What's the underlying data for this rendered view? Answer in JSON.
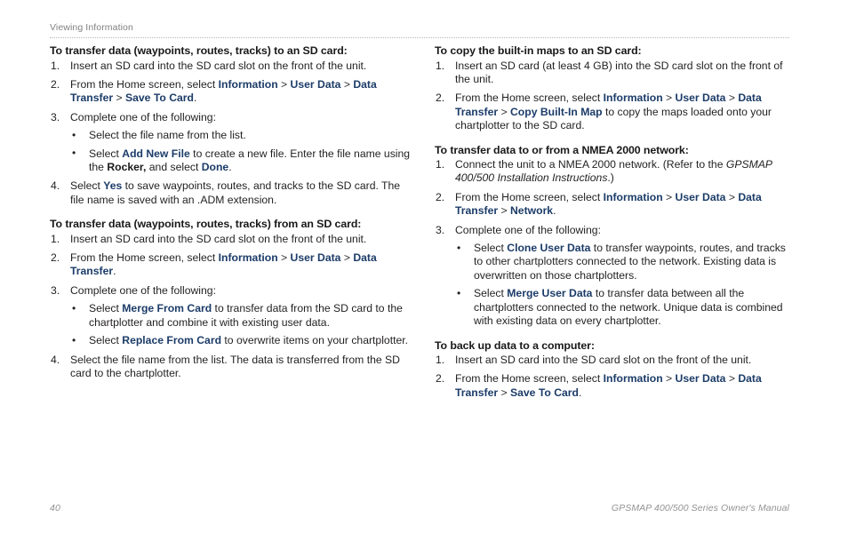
{
  "header": {
    "running_title": "Viewing Information"
  },
  "footer": {
    "page_number": "40",
    "manual_title": "GPSMAP 400/500 Series Owner's Manual"
  },
  "chevron": ">",
  "bullet_glyph": "•",
  "colors": {
    "ui_label_blue": "#1c3c68",
    "body_text": "#221f1f",
    "heading": "#191919",
    "muted_gray": "#939393",
    "rule_gray": "#b9b9b9",
    "page_background": "#ffffff"
  },
  "left_column": {
    "sections": [
      {
        "heading": "To transfer data (waypoints, routes, tracks) to an SD card:",
        "steps": [
          {
            "number": "1.",
            "parts": [
              {
                "type": "text",
                "text": "Insert an SD card into the SD card slot on the front of the unit."
              }
            ]
          },
          {
            "number": "2.",
            "parts": [
              {
                "type": "text",
                "text": "From the Home screen, select "
              },
              {
                "type": "ui",
                "text": "Information"
              },
              {
                "type": "sep",
                "text": " > "
              },
              {
                "type": "ui",
                "text": "User Data"
              },
              {
                "type": "sep",
                "text": " > "
              },
              {
                "type": "ui",
                "text": "Data Transfer"
              },
              {
                "type": "sep",
                "text": " > "
              },
              {
                "type": "ui",
                "text": "Save To Card"
              },
              {
                "type": "text",
                "text": "."
              }
            ]
          },
          {
            "number": "3.",
            "parts": [
              {
                "type": "text",
                "text": "Complete one of the following:"
              }
            ],
            "bullets": [
              {
                "parts": [
                  {
                    "type": "text",
                    "text": "Select the file name from the list."
                  }
                ]
              },
              {
                "parts": [
                  {
                    "type": "text",
                    "text": "Select "
                  },
                  {
                    "type": "ui",
                    "text": "Add New File"
                  },
                  {
                    "type": "text",
                    "text": " to create a new file. Enter the file name using the "
                  },
                  {
                    "type": "kb",
                    "text": "Rocker,"
                  },
                  {
                    "type": "text",
                    "text": " and select "
                  },
                  {
                    "type": "ui",
                    "text": "Done"
                  },
                  {
                    "type": "text",
                    "text": "."
                  }
                ]
              }
            ]
          },
          {
            "number": "4.",
            "parts": [
              {
                "type": "text",
                "text": "Select "
              },
              {
                "type": "ui",
                "text": "Yes"
              },
              {
                "type": "text",
                "text": " to save waypoints, routes, and tracks to the SD card. The file name is saved with an .ADM extension."
              }
            ]
          }
        ]
      },
      {
        "heading": "To transfer data (waypoints, routes, tracks) from an SD card:",
        "steps": [
          {
            "number": "1.",
            "parts": [
              {
                "type": "text",
                "text": "Insert an SD card into the SD card slot on the front of the unit."
              }
            ]
          },
          {
            "number": "2.",
            "parts": [
              {
                "type": "text",
                "text": "From the Home screen, select "
              },
              {
                "type": "ui",
                "text": "Information"
              },
              {
                "type": "sep",
                "text": " > "
              },
              {
                "type": "ui",
                "text": "User Data"
              },
              {
                "type": "sep",
                "text": " > "
              },
              {
                "type": "ui",
                "text": "Data Transfer"
              },
              {
                "type": "text",
                "text": "."
              }
            ]
          },
          {
            "number": "3.",
            "parts": [
              {
                "type": "text",
                "text": "Complete one of the following:"
              }
            ],
            "bullets": [
              {
                "parts": [
                  {
                    "type": "text",
                    "text": "Select "
                  },
                  {
                    "type": "ui",
                    "text": "Merge From Card"
                  },
                  {
                    "type": "text",
                    "text": " to transfer data from the SD card to the chartplotter and combine it with existing user data."
                  }
                ]
              },
              {
                "parts": [
                  {
                    "type": "text",
                    "text": "Select "
                  },
                  {
                    "type": "ui",
                    "text": "Replace From Card"
                  },
                  {
                    "type": "text",
                    "text": " to overwrite items on your chartplotter."
                  }
                ]
              }
            ]
          },
          {
            "number": "4.",
            "parts": [
              {
                "type": "text",
                "text": "Select the file name from the list. The data is transferred from the SD card to the chartplotter."
              }
            ]
          }
        ]
      }
    ]
  },
  "right_column": {
    "sections": [
      {
        "heading": "To copy the built-in maps to an SD card:",
        "steps": [
          {
            "number": "1.",
            "parts": [
              {
                "type": "text",
                "text": "Insert an SD card (at least 4 GB) into the SD card slot on the front of the unit."
              }
            ]
          },
          {
            "number": "2.",
            "parts": [
              {
                "type": "text",
                "text": "From the Home screen, select "
              },
              {
                "type": "ui",
                "text": "Information"
              },
              {
                "type": "sep",
                "text": " > "
              },
              {
                "type": "ui",
                "text": "User Data"
              },
              {
                "type": "sep",
                "text": " > "
              },
              {
                "type": "ui",
                "text": "Data Transfer"
              },
              {
                "type": "sep",
                "text": " > "
              },
              {
                "type": "ui",
                "text": "Copy Built-In Map"
              },
              {
                "type": "text",
                "text": " to copy the maps loaded onto your chartplotter to the SD card."
              }
            ]
          }
        ]
      },
      {
        "heading": "To transfer data to or from a NMEA 2000 network:",
        "steps": [
          {
            "number": "1.",
            "parts": [
              {
                "type": "text",
                "text": "Connect the unit to a NMEA 2000 network. (Refer to the "
              },
              {
                "type": "italic",
                "text": "GPSMAP 400/500 Installation Instructions"
              },
              {
                "type": "text",
                "text": ".)"
              }
            ]
          },
          {
            "number": "2.",
            "parts": [
              {
                "type": "text",
                "text": "From the Home screen, select "
              },
              {
                "type": "ui",
                "text": "Information"
              },
              {
                "type": "sep",
                "text": " > "
              },
              {
                "type": "ui",
                "text": "User Data"
              },
              {
                "type": "sep",
                "text": " > "
              },
              {
                "type": "ui",
                "text": "Data Transfer"
              },
              {
                "type": "sep",
                "text": " > "
              },
              {
                "type": "ui",
                "text": "Network"
              },
              {
                "type": "text",
                "text": "."
              }
            ]
          },
          {
            "number": "3.",
            "parts": [
              {
                "type": "text",
                "text": "Complete one of the following:"
              }
            ],
            "bullets": [
              {
                "parts": [
                  {
                    "type": "text",
                    "text": "Select "
                  },
                  {
                    "type": "ui",
                    "text": "Clone User Data"
                  },
                  {
                    "type": "text",
                    "text": " to transfer waypoints, routes, and tracks to other chartplotters connected to the network. Existing data is overwritten on those chartplotters."
                  }
                ]
              },
              {
                "parts": [
                  {
                    "type": "text",
                    "text": "Select "
                  },
                  {
                    "type": "ui",
                    "text": "Merge User Data"
                  },
                  {
                    "type": "text",
                    "text": " to transfer data between all the chartplotters connected to the network. Unique data is combined with existing data on every chartplotter."
                  }
                ]
              }
            ]
          }
        ]
      },
      {
        "heading": "To back up data to a computer:",
        "steps": [
          {
            "number": "1.",
            "parts": [
              {
                "type": "text",
                "text": "Insert an SD card into the SD card slot on the front of the unit."
              }
            ]
          },
          {
            "number": "2.",
            "parts": [
              {
                "type": "text",
                "text": "From the Home screen, select "
              },
              {
                "type": "ui",
                "text": "Information"
              },
              {
                "type": "sep",
                "text": " > "
              },
              {
                "type": "ui",
                "text": "User Data"
              },
              {
                "type": "sep",
                "text": " > "
              },
              {
                "type": "ui",
                "text": "Data Transfer"
              },
              {
                "type": "sep",
                "text": " > "
              },
              {
                "type": "ui",
                "text": "Save To Card"
              },
              {
                "type": "text",
                "text": "."
              }
            ]
          }
        ]
      }
    ]
  }
}
